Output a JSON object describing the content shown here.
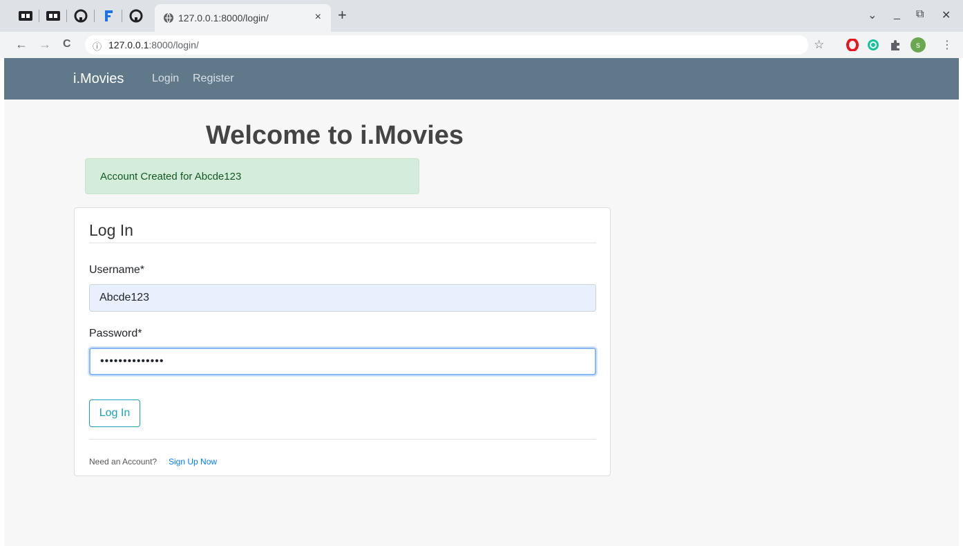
{
  "browser": {
    "tab_title": "127.0.0.1:8000/login/",
    "tab_close": "×",
    "new_tab": "+",
    "url_host": "127.0.0.1",
    "url_path": ":8000/login/",
    "nav_back": "←",
    "nav_forward": "→",
    "nav_reload": "C",
    "info_icon": "ⓘ",
    "star_icon": "☆",
    "profile_letter": "s",
    "window_controls": [
      "⌄",
      "_",
      "⧉",
      "✕"
    ]
  },
  "navbar": {
    "brand": "i.Movies",
    "links": [
      "Login",
      "Register"
    ]
  },
  "page": {
    "heading": "Welcome to i.Movies",
    "alert": "Account Created for Abcde123"
  },
  "form": {
    "legend": "Log In",
    "username_label": "Username*",
    "username_value": "Abcde123",
    "password_label": "Password*",
    "password_value": "••••••••••••••",
    "submit_label": "Log In",
    "footer_text": "Need an Account?",
    "signup_link": "Sign Up Now"
  },
  "colors": {
    "navbar": "#5f788a",
    "alert_bg": "#d4edda",
    "alert_text": "#155724",
    "button_accent": "#17a2b8",
    "link": "#007bff"
  }
}
